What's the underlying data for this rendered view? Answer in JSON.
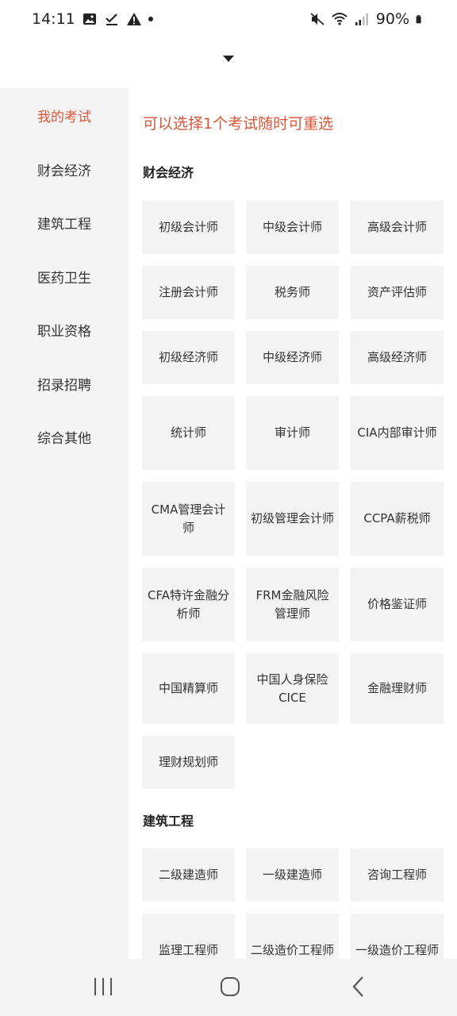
{
  "status_bar": {
    "time": "14:11",
    "battery": "90%"
  },
  "sidebar": {
    "items": [
      {
        "label": "我的考试",
        "active": true
      },
      {
        "label": "财会经济"
      },
      {
        "label": "建筑工程"
      },
      {
        "label": "医药卫生"
      },
      {
        "label": "职业资格"
      },
      {
        "label": "招录招聘"
      },
      {
        "label": "综合其他"
      }
    ]
  },
  "content": {
    "hint": "可以选择1个考试随时可重选",
    "sections": [
      {
        "title": "财会经济",
        "items": [
          "初级会计师",
          "中级会计师",
          "高级会计师",
          "注册会计师",
          "税务师",
          "资产评估师",
          "初级经济师",
          "中级经济师",
          "高级经济师",
          "统计师",
          "审计师",
          "CIA内部审计师",
          "CMA管理会计师",
          "初级管理会计师",
          "CCPA薪税师",
          "CFA特许金融分析师",
          "FRM金融风险管理师",
          "价格鉴证师",
          "中国精算师",
          "中国人身保险CICE",
          "金融理财师",
          "理财规划师"
        ]
      },
      {
        "title": "建筑工程",
        "items": [
          "二级建造师",
          "一级建造师",
          "咨询工程师",
          "监理工程师",
          "二级造价工程师",
          "一级造价工程师"
        ]
      }
    ]
  },
  "colors": {
    "accent": "#d9573a",
    "sidebar_bg": "#f4f4f4",
    "card_bg": "#f3f3f3"
  }
}
